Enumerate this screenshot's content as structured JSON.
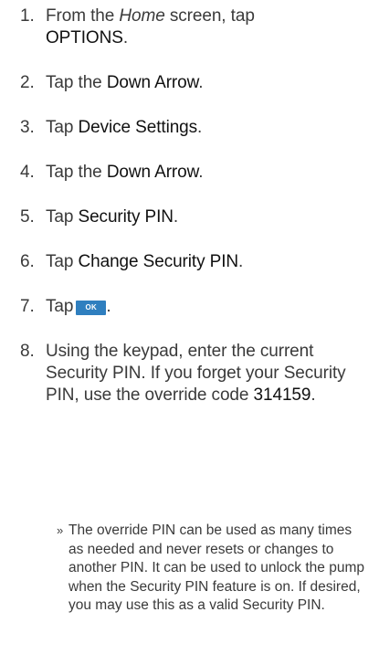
{
  "steps": [
    {
      "num": "1.",
      "pre": "From the ",
      "em": "Home",
      "mid": " screen, tap",
      "strong": "OPTIONS",
      "post": "."
    },
    {
      "num": "2.",
      "pre": "Tap the ",
      "strong": "Down Arrow",
      "post": "."
    },
    {
      "num": "3.",
      "pre": "Tap ",
      "strong": "Device Settings",
      "post": "."
    },
    {
      "num": "4.",
      "pre": "Tap the ",
      "strong": "Down Arrow",
      "post": "."
    },
    {
      "num": "5.",
      "pre": "Tap ",
      "strong": "Security PIN",
      "post": "."
    },
    {
      "num": "6.",
      "pre": "Tap ",
      "strong": "Change Security PIN",
      "post": "."
    },
    {
      "num": "7.",
      "pre": "Tap",
      "button": "OK",
      "post": "."
    },
    {
      "num": "8.",
      "pre": "Using the keypad, enter the current Security PIN. If you forget your Security PIN, use the override code ",
      "strong": "314159",
      "post": "."
    }
  ],
  "note": {
    "bullet": "»",
    "text": "The override PIN can be used as many times as needed and never resets or changes to another PIN. It can be used to unlock the pump when the Security PIN feature is on. If desired, you may use this as a valid Security PIN."
  }
}
